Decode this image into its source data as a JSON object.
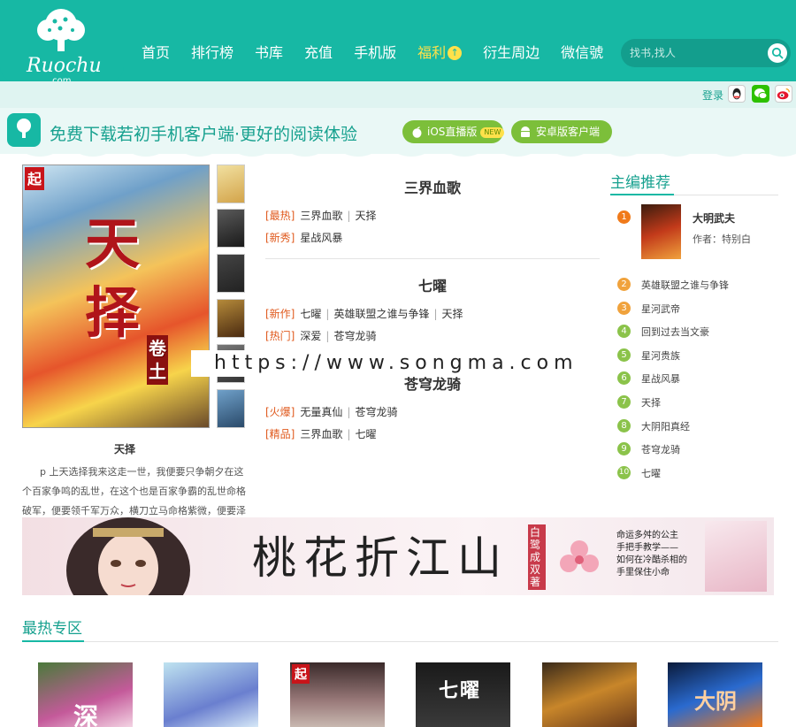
{
  "brand": {
    "logo_text": "Ruochu",
    "logo_sub": ".com"
  },
  "nav": [
    {
      "label": "首页"
    },
    {
      "label": "排行榜"
    },
    {
      "label": "书库"
    },
    {
      "label": "充值"
    },
    {
      "label": "手机版"
    },
    {
      "label": "福利",
      "hot": true
    },
    {
      "label": "衍生周边"
    },
    {
      "label": "微信號"
    }
  ],
  "search": {
    "placeholder": "找书,找人"
  },
  "user": {
    "login_label": "登录"
  },
  "social_icons": [
    "qq-icon",
    "wechat-icon",
    "weibo-icon"
  ],
  "promo": {
    "text": "免费下载若初手机客户端·更好的阅读体验",
    "ios_label": "iOS直播版",
    "ios_badge": "NEW",
    "android_label": "安卓版客户端"
  },
  "featured_book": {
    "title": "天择",
    "cover_text_big": "天择",
    "cover_text_side": "卷土",
    "cover_logo": "起",
    "description": "p 上天选择我来这走一世，我便要只争朝夕在这个百家争鸣的乱世，在这个也是百家争霸的乱世命格破军，便要领千军万众，横刀立马命格紫微，便要泽被苍"
  },
  "sections": [
    {
      "title": "三界血歌",
      "rows": [
        {
          "tag": "[最热]",
          "items": [
            "三界血歌",
            "天择"
          ]
        },
        {
          "tag": "[新秀]",
          "items": [
            "星战风暴"
          ]
        }
      ]
    },
    {
      "title": "七曜",
      "rows": [
        {
          "tag": "[新作]",
          "items": [
            "七曜",
            "英雄联盟之谁与争锋",
            "天择"
          ]
        },
        {
          "tag": "[热门]",
          "items": [
            "深爱",
            "苍穹龙骑"
          ]
        }
      ]
    },
    {
      "title": "苍穹龙骑",
      "rows": [
        {
          "tag": "[火爆]",
          "items": [
            "无量真仙",
            "苍穹龙骑"
          ]
        },
        {
          "tag": "[精品]",
          "items": [
            "三界血歌",
            "七曜"
          ]
        }
      ]
    }
  ],
  "watermark": "https://www.songma.com",
  "editor_picks": {
    "title": "主编推荐",
    "featured": {
      "rank": "1",
      "title": "大明武夫",
      "author": "作者：特别白"
    },
    "items": [
      {
        "rank": "2",
        "title": "英雄联盟之谁与争锋"
      },
      {
        "rank": "3",
        "title": "星河武帝"
      },
      {
        "rank": "4",
        "title": "回到过去当文豪"
      },
      {
        "rank": "5",
        "title": "星河贵族"
      },
      {
        "rank": "6",
        "title": "星战风暴"
      },
      {
        "rank": "7",
        "title": "天择"
      },
      {
        "rank": "8",
        "title": "大阴阳真经"
      },
      {
        "rank": "9",
        "title": "苍穹龙骑"
      },
      {
        "rank": "10",
        "title": "七曜"
      }
    ]
  },
  "banner": {
    "title": "桃花折江山",
    "author_tag": "白鹭成双 著",
    "tagline": "命运多舛的公主\n手把手教学——\n如何在冷酷杀相的\n手里保住小命"
  },
  "hot_zone": {
    "title": "最热专区",
    "covers": [
      {
        "text": "深"
      },
      {
        "text": ""
      },
      {
        "text": "起"
      },
      {
        "text": "七曜"
      },
      {
        "text": ""
      },
      {
        "text": "大阴"
      }
    ]
  },
  "colors": {
    "brand": "#17b8a4",
    "accent_text": "#17a18f",
    "tag": "#e05a1e",
    "rank1": "#f07a1a",
    "rank2_3": "#f0a23c",
    "rank_rest": "#8bc34a"
  }
}
